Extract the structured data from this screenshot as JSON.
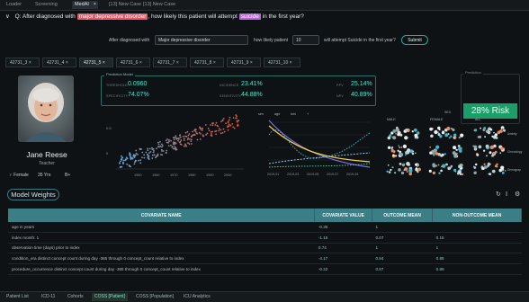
{
  "window_tabs": [
    "Loader",
    "Screening",
    "MedAI",
    "[13] New Case",
    "[13] New Case"
  ],
  "question": {
    "prefix": "Q: After diagnosed with",
    "condition": "major depressive disorder",
    "middle": ", how likely this patient will attempt",
    "outcome": "suicide",
    "suffix": "in the first year?"
  },
  "form": {
    "label1": "After diagnosed with",
    "condition_value": "Major depressive disorder",
    "label2": "how likely patient",
    "patient_value": "10",
    "label3": "will attempt Suicide in the first year?",
    "submit": "Submit"
  },
  "patient_tabs": [
    "42731_3",
    "42731_4",
    "42731_5",
    "42731_6",
    "42731_7",
    "42731_8",
    "42731_9",
    "42731_10"
  ],
  "patient": {
    "name": "Jane Reese",
    "occupation": "Teacher",
    "sex": "Female",
    "age": "35 Yrs",
    "blood": "B+"
  },
  "prediction_model": {
    "label": "Prediction Model",
    "metrics": [
      {
        "label": "THRESHOLD",
        "value": "0.0960"
      },
      {
        "label": "INCIDENCE",
        "value": "23.41%"
      },
      {
        "label": "PPV",
        "value": "25.14%"
      },
      {
        "label": "SPECIFICITY",
        "value": "74.07%"
      },
      {
        "label": "SENSITIVITY",
        "value": "44.88%"
      },
      {
        "label": "NPV",
        "value": "40.89%"
      }
    ]
  },
  "prediction": {
    "label": "Prediction",
    "risk_text": "28% Risk",
    "color": "#1b9e6a"
  },
  "heatmap": {
    "cols": [
      "MALE",
      "FEMALE",
      "ALL"
    ],
    "rows": [
      "Anxiety",
      "Chronology",
      "Demograp"
    ],
    "top": "SEX"
  },
  "chart1": {
    "x_ticks": [
      "1950",
      "1960",
      "1970",
      "1980",
      "1990",
      "2000"
    ]
  },
  "chart2": {
    "legend": [
      "sex",
      "age",
      "bmi",
      "+"
    ],
    "x_ticks": [
      "2019-01",
      "2019-03",
      "2019-05",
      "2019-07",
      "2019-09"
    ]
  },
  "model_weights": {
    "label": "Model Weights"
  },
  "table": {
    "headers": [
      "COVARIATE NAME",
      "COVARIATE VALUE",
      "OUTCOME MEAN",
      "NON-OUTCOME MEAN"
    ],
    "rows": [
      [
        "age in years",
        "-0.36",
        "1",
        ""
      ],
      [
        "index month: 1",
        "-1.15",
        "0.07",
        "0.15"
      ],
      [
        "observation time (days) prior to index",
        "0.74",
        "1",
        "1"
      ],
      [
        "condition_era distinct concept count during day -365 through 0 concept_count relative to index",
        "-4.17",
        "0.84",
        "0.85"
      ],
      [
        "procedure_occurrence distinct concept count during day -365 through 0 concept_count relative to index",
        "-0.22",
        "0.87",
        "0.89"
      ]
    ]
  },
  "bottom_tabs": [
    "Patient List",
    "ICD-11",
    "Cohorts",
    "COSS [Patient]",
    "COSS [Population]",
    "ICU Analytics"
  ],
  "colors": {
    "accent": "#53e0cb",
    "header": "#3c7e86",
    "risk": "#1b9e6a"
  }
}
